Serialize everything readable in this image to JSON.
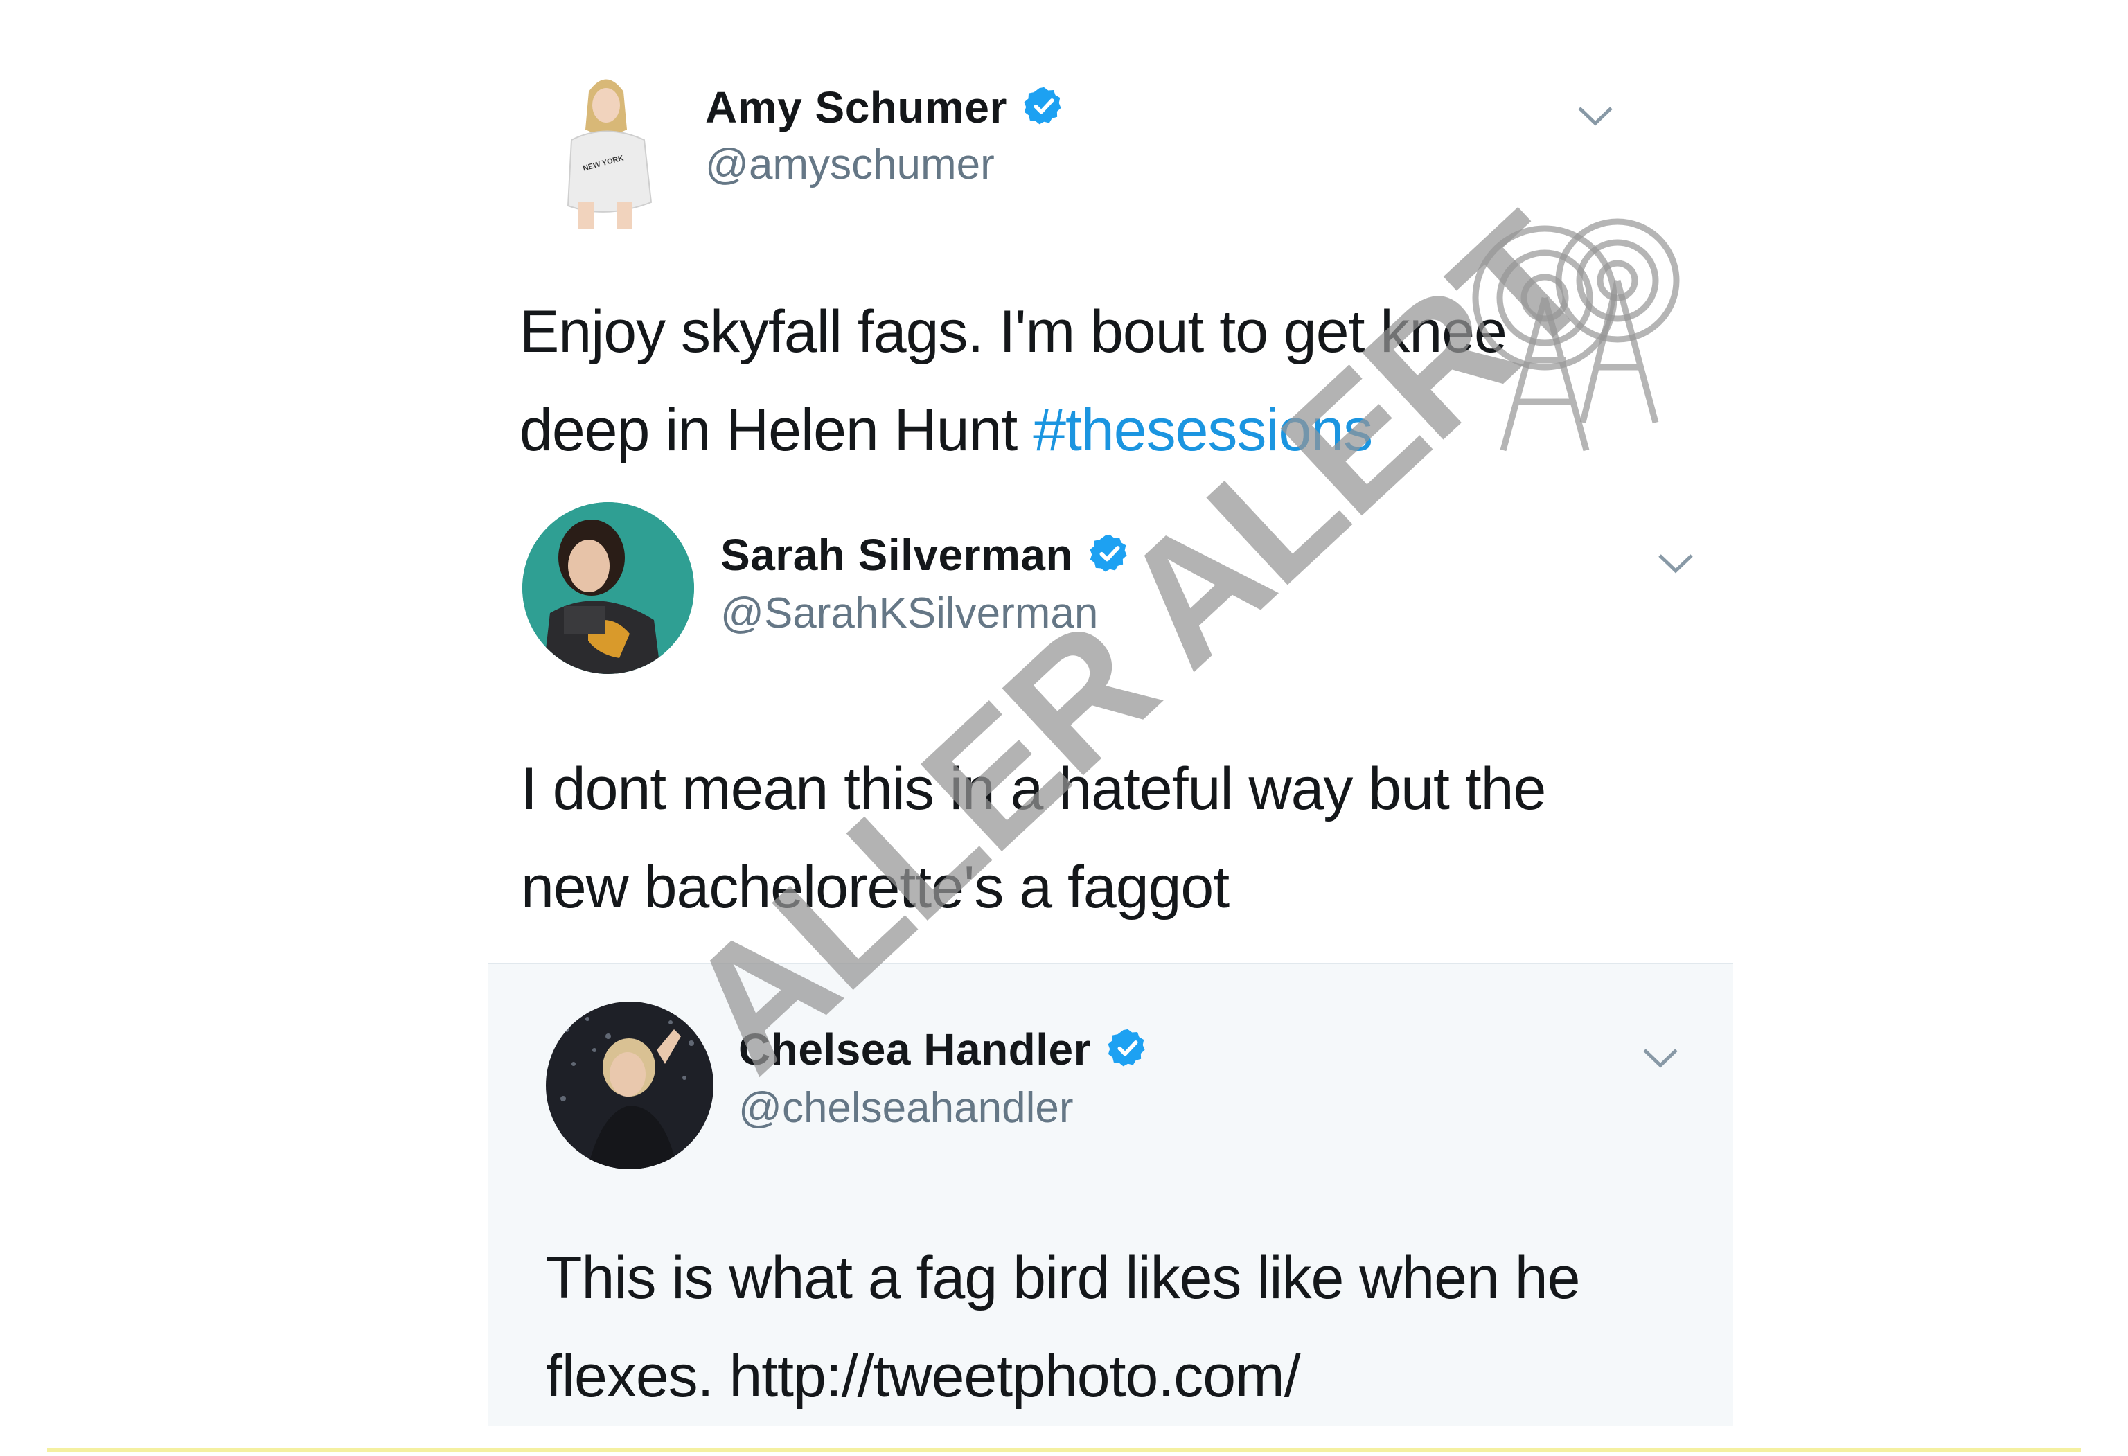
{
  "tweets": [
    {
      "display_name": "Amy Schumer",
      "handle": "@amyschumer",
      "verified": true,
      "shirt_text": "NEW YORK",
      "text_line1": "Enjoy skyfall fags. I'm bout to get knee",
      "text_line2_plain": "deep in Helen Hunt ",
      "text_line2_hashtag": "#thesessions"
    },
    {
      "display_name": "Sarah Silverman",
      "handle": "@SarahKSilverman",
      "verified": true,
      "text_line1": "I dont mean this in a hateful way but the",
      "text_line2": "new bachelorette's a faggot"
    },
    {
      "display_name": "Chelsea Handler",
      "handle": "@chelseahandler",
      "verified": true,
      "text_line1": "This is what a fag bird likes like when he",
      "text_line2": "flexes.  http://tweetphoto.com/"
    }
  ],
  "watermark": {
    "text": "ALLER ALERT"
  },
  "colors": {
    "name": "#14171a",
    "handle": "#657786",
    "hashtag": "#1b95e0",
    "verified": "#1da1f2",
    "card_bg": "#f5f8fa",
    "watermark": "#969696"
  },
  "icons": [
    "verified-badge-icon",
    "chevron-down-icon",
    "radio-tower-icon"
  ]
}
